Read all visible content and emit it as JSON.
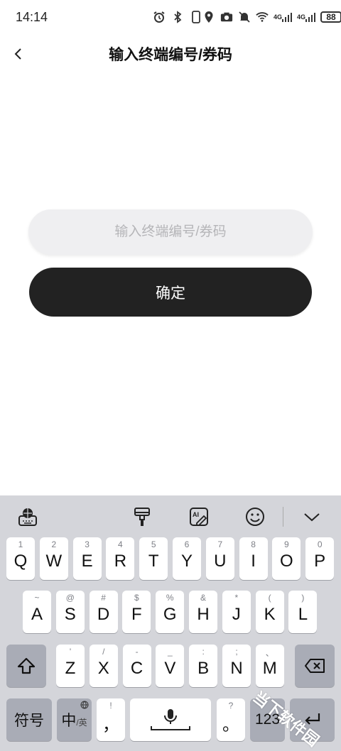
{
  "status_bar": {
    "time": "14:14",
    "network_label_1": "4G",
    "network_label_2": "4G",
    "battery": "88",
    "icons": [
      "alarm-icon",
      "bluetooth-icon",
      "phone-icon",
      "location-icon",
      "camera-icon",
      "mute-icon",
      "wifi-icon",
      "signal-icon",
      "signal-icon",
      "battery-icon"
    ]
  },
  "header": {
    "title": "输入终端编号/券码",
    "back_icon": "chevron-left-icon"
  },
  "form": {
    "input_placeholder": "输入终端编号/券码",
    "input_value": "",
    "confirm_label": "确定"
  },
  "keyboard": {
    "toolbar_icons": [
      "keyboard-settings-icon",
      "brush-icon",
      "ai-edit-icon",
      "emoji-icon",
      "collapse-icon"
    ],
    "row1": [
      {
        "main": "Q",
        "hint": "1"
      },
      {
        "main": "W",
        "hint": "2"
      },
      {
        "main": "E",
        "hint": "3"
      },
      {
        "main": "R",
        "hint": "4"
      },
      {
        "main": "T",
        "hint": "5"
      },
      {
        "main": "Y",
        "hint": "6"
      },
      {
        "main": "U",
        "hint": "7"
      },
      {
        "main": "I",
        "hint": "8"
      },
      {
        "main": "O",
        "hint": "9"
      },
      {
        "main": "P",
        "hint": "0"
      }
    ],
    "row2": [
      {
        "main": "A",
        "hint": "~"
      },
      {
        "main": "S",
        "hint": "@"
      },
      {
        "main": "D",
        "hint": "#"
      },
      {
        "main": "F",
        "hint": "$"
      },
      {
        "main": "G",
        "hint": "%"
      },
      {
        "main": "H",
        "hint": "&"
      },
      {
        "main": "J",
        "hint": "*"
      },
      {
        "main": "K",
        "hint": "("
      },
      {
        "main": "L",
        "hint": ")"
      }
    ],
    "row3": [
      {
        "main": "Z",
        "hint": "'"
      },
      {
        "main": "X",
        "hint": "/"
      },
      {
        "main": "C",
        "hint": "-"
      },
      {
        "main": "V",
        "hint": "_"
      },
      {
        "main": "B",
        "hint": ":"
      },
      {
        "main": "N",
        "hint": ";"
      },
      {
        "main": "M",
        "hint": "、"
      }
    ],
    "symbols_label": "符号",
    "lang_main": "中",
    "lang_sub": "/英",
    "comma_main": "，",
    "comma_hint": "!",
    "period_main": "。",
    "period_hint": "?",
    "numbers_label": "123"
  },
  "watermark": "当下软件园"
}
